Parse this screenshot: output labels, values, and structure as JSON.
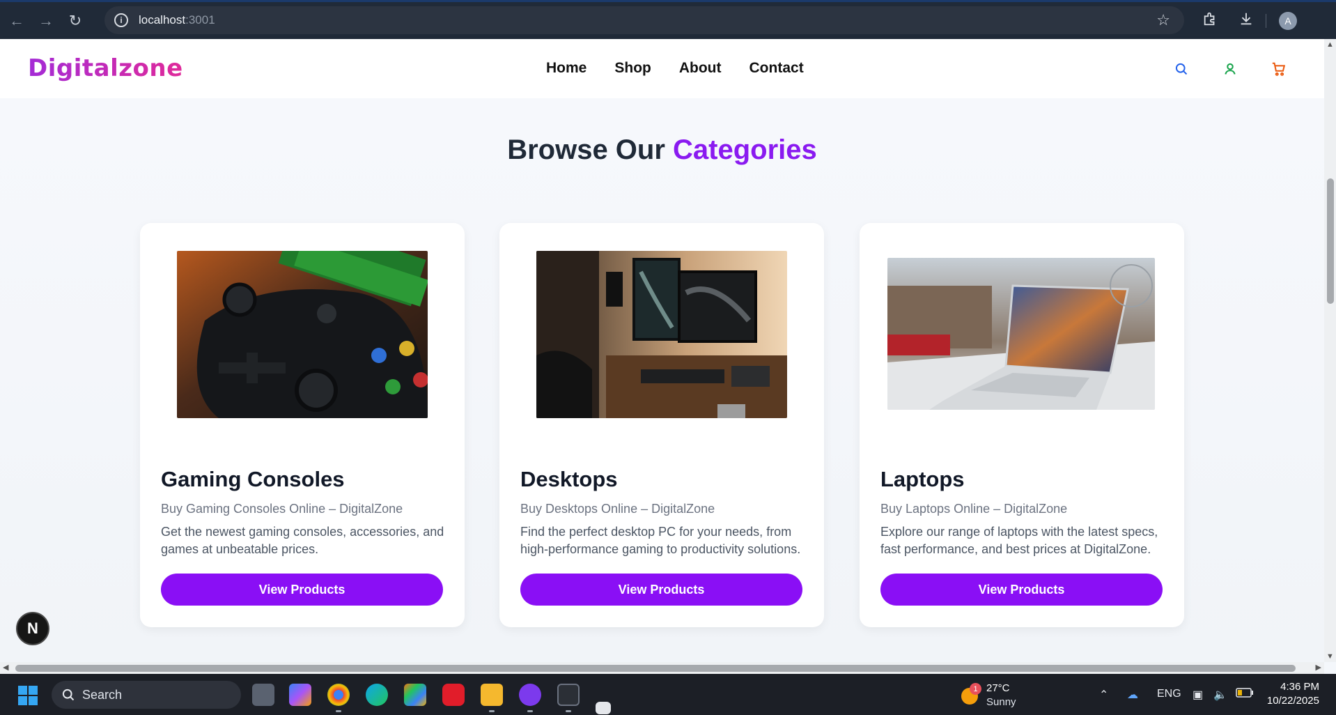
{
  "browser": {
    "url_host": "localhost",
    "url_port": ":3001",
    "profile_initial": "A"
  },
  "site": {
    "logo": "Digitalzone",
    "nav": [
      "Home",
      "Shop",
      "About",
      "Contact"
    ],
    "icons": [
      "search-icon",
      "user-icon",
      "cart-icon"
    ],
    "colors": {
      "accent": "#8a0ff5",
      "logo_start": "#a42bd6",
      "logo_end": "#e02a9a"
    }
  },
  "section": {
    "title_plain": "Browse Our ",
    "title_accent": "Categories"
  },
  "categories": [
    {
      "title": "Gaming Consoles",
      "subtitle": "Buy Gaming Consoles Online – DigitalZone",
      "description": "Get the newest gaming consoles, accessories, and games at unbeatable prices.",
      "button": "View Products",
      "image": "game-controller-photo"
    },
    {
      "title": "Desktops",
      "subtitle": "Buy Desktops Online – DigitalZone",
      "description": "Find the perfect desktop PC for your needs, from high-performance gaming to productivity solutions.",
      "button": "View Products",
      "image": "desktop-setup-photo"
    },
    {
      "title": "Laptops",
      "subtitle": "Buy Laptops Online – DigitalZone",
      "description": "Explore our range of laptops with the latest specs, fast performance, and best prices at DigitalZone.",
      "button": "View Products",
      "image": "laptop-photo"
    }
  ],
  "fab_label": "N",
  "taskbar": {
    "search_label": "Search",
    "weather_badge": "1",
    "temperature": "27°C",
    "condition": "Sunny",
    "language": "ENG",
    "time": "4:36 PM",
    "date": "10/22/2025"
  }
}
